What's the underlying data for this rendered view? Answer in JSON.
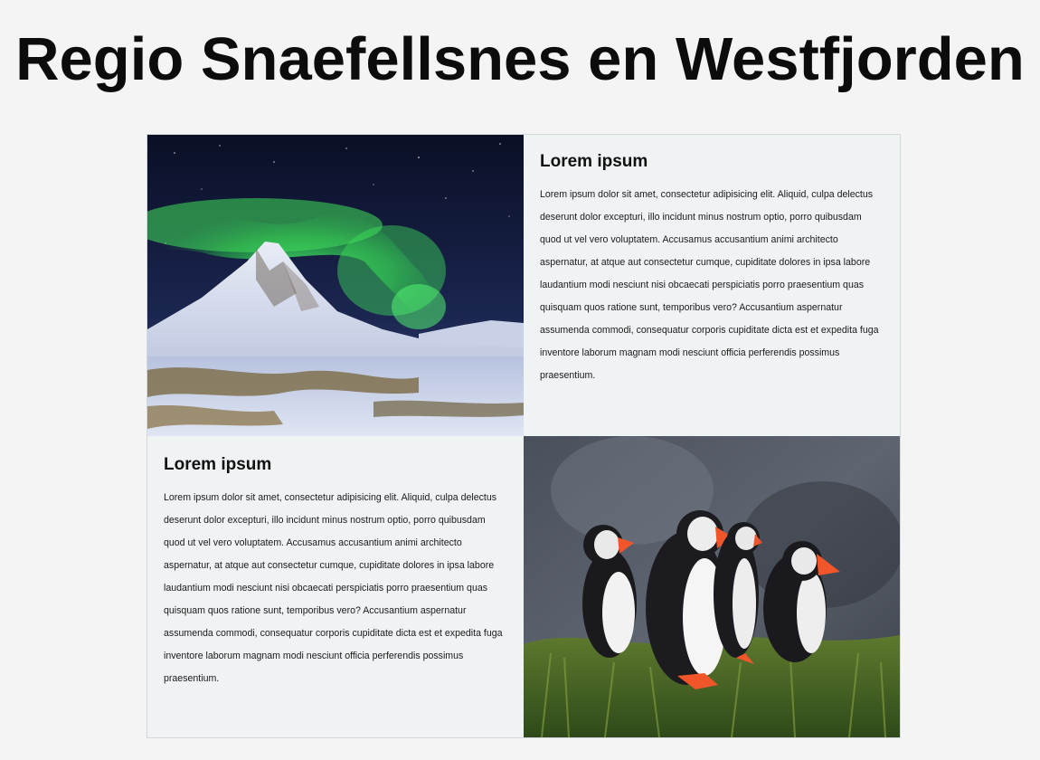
{
  "page": {
    "title": "Regio Snaefellsnes en Westfjorden"
  },
  "sections": [
    {
      "heading": "Lorem ipsum",
      "body": "Lorem ipsum dolor sit amet, consectetur adipisicing elit. Aliquid, culpa delectus deserunt dolor excepturi, illo incidunt minus nostrum optio, porro quibusdam quod ut vel vero voluptatem. Accusamus accusantium animi architecto aspernatur, at atque aut consectetur cumque, cupiditate dolores in ipsa labore laudantium modi nesciunt nisi obcaecati perspiciatis porro praesentium quas quisquam quos ratione sunt, temporibus vero? Accusantium aspernatur assumenda commodi, consequatur corporis cupiditate dicta est et expedita fuga inventore laborum magnam modi nesciunt officia perferendis possimus praesentium."
    },
    {
      "heading": "Lorem ipsum",
      "body": "Lorem ipsum dolor sit amet, consectetur adipisicing elit. Aliquid, culpa delectus deserunt dolor excepturi, illo incidunt minus nostrum optio, porro quibusdam quod ut vel vero voluptatem. Accusamus accusantium animi architecto aspernatur, at atque aut consectetur cumque, cupiditate dolores in ipsa labore laudantium modi nesciunt nisi obcaecati perspiciatis porro praesentium quas quisquam quos ratione sunt, temporibus vero? Accusantium aspernatur assumenda commodi, consequatur corporis cupiditate dicta est et expedita fuga inventore laborum magnam modi nesciunt officia perferendis possimus praesentium."
    }
  ],
  "colors": {
    "background": "#f4f4f4",
    "card_background": "#eff3f4",
    "aurora": "#3fe05a",
    "puffin_beak": "#f0562a"
  },
  "images": {
    "top": "aurora-mountain-photo",
    "bottom": "puffins-photo"
  }
}
